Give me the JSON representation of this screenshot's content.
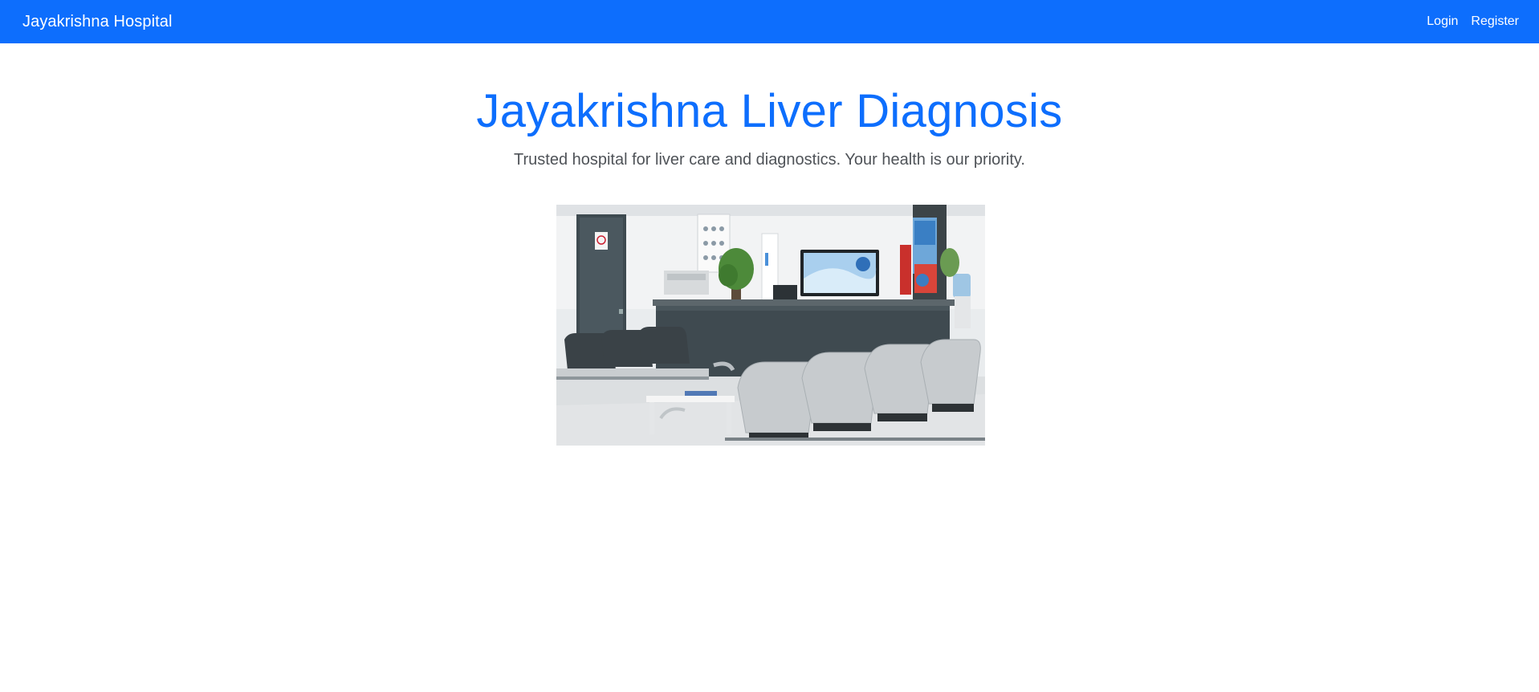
{
  "navbar": {
    "brand": "Jayakrishna Hospital",
    "links": [
      {
        "label": "Login"
      },
      {
        "label": "Register"
      }
    ],
    "color": "#0d6efd"
  },
  "hero": {
    "title": "Jayakrishna Liver Diagnosis",
    "subtitle": "Trusted hospital for liver care and diagnostics. Your health is our priority."
  },
  "image": {
    "icon": "hospital-waiting-room-photo"
  }
}
